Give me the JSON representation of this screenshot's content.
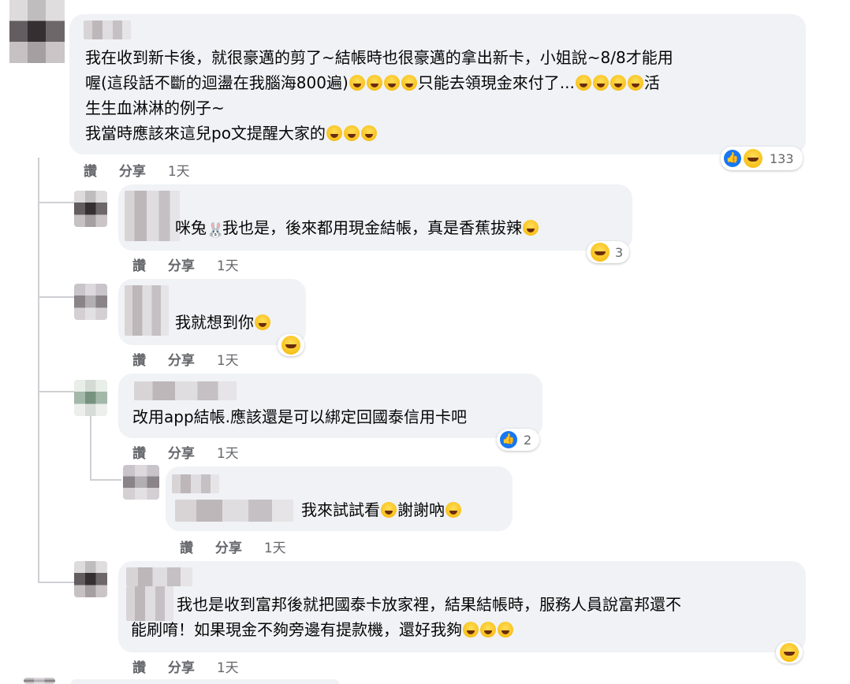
{
  "actions": {
    "like": "讚",
    "share": "分享",
    "time": "1天"
  },
  "comments": [
    {
      "lines": [
        "我在收到新卡後，就很豪邁的剪了~結帳時也很豪邁的拿出新卡，小姐說~8/8才能用",
        "喔(這段話不斷的迴盪在我腦海800遍)",
        "只能去領現金來付了...",
        "活",
        "生生血淋淋的例子~",
        "我當時應該來這兒po文提醒大家的"
      ],
      "reaction_count": "133"
    },
    {
      "lines": [
        "咪兔",
        "我也是，後來都用現金結帳，真是香蕉拔辣"
      ],
      "reaction_count": "3"
    },
    {
      "lines": [
        "我就想到你"
      ]
    },
    {
      "lines": [
        "改用app結帳.應該還是可以綁定回國泰信用卡吧"
      ],
      "reaction_count": "2"
    },
    {
      "lines": [
        "我來試試看",
        "謝謝吶"
      ]
    },
    {
      "lines": [
        "我也是收到富邦後就把國泰卡放家裡，結果結帳時，服務人員說富邦還不",
        "能刷唷！如果現金不夠旁邊有提款機，還好我夠"
      ]
    }
  ],
  "icons": {
    "like": "like-icon",
    "laugh": "laughing-emoji-icon",
    "rolling": "rolling-laughing-emoji-icon",
    "rabbit": "rabbit-icon"
  },
  "colors": {
    "bubble": "#f0f2f5",
    "text": "#050505",
    "meta": "#65676b",
    "like_blue": "#1877f2"
  }
}
